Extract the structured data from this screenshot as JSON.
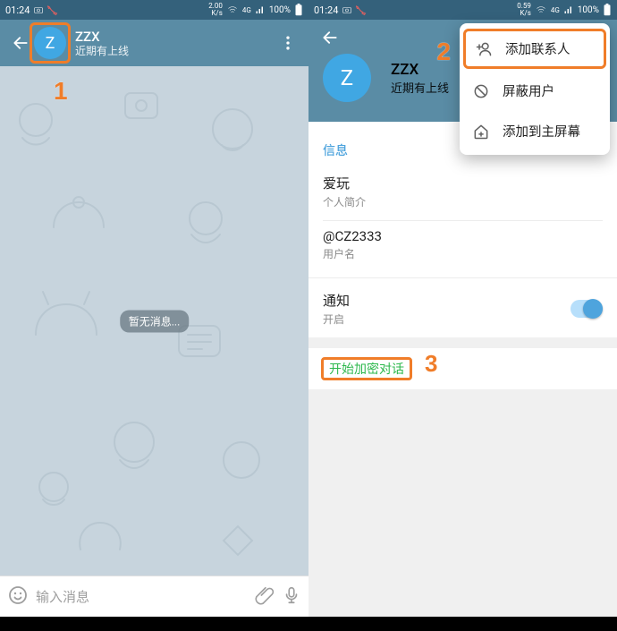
{
  "status": {
    "time": "01:24",
    "net_speed_left": "2.00\nK/s",
    "net_speed_right": "0.59\nK/s",
    "signal": "4G",
    "battery": "100%"
  },
  "left": {
    "contact_initial": "Z",
    "contact_name": "ZZX",
    "contact_status": "近期有上线",
    "empty_state": "暂无消息...",
    "input_placeholder": "输入消息",
    "annotation": "1"
  },
  "right": {
    "contact_initial": "Z",
    "contact_name": "ZZX",
    "contact_status": "近期有上线",
    "section_info_title": "信息",
    "bio_value": "爱玩",
    "bio_label": "个人简介",
    "username_value": "@CZ2333",
    "username_label": "用户名",
    "notif_title": "通知",
    "notif_state": "开启",
    "encrypted_chat": "开始加密对话",
    "annotation_menu": "2",
    "annotation_enc": "3",
    "menu": {
      "add_contact": "添加联系人",
      "block_user": "屏蔽用户",
      "add_to_home": "添加到主屏幕"
    }
  }
}
